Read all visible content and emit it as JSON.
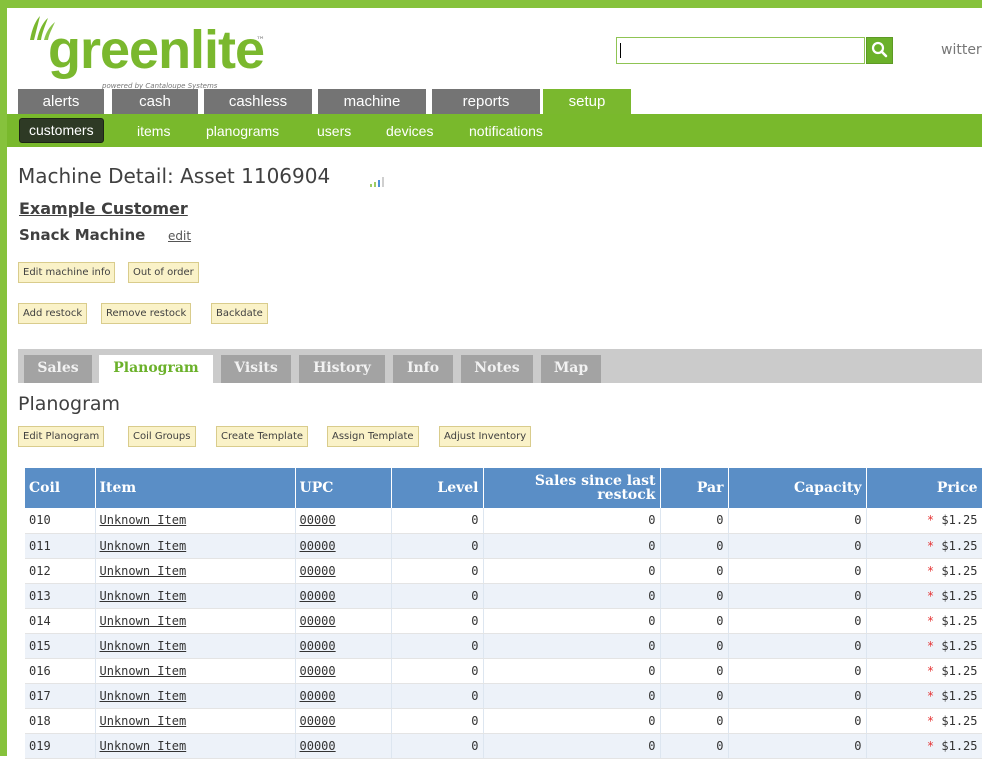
{
  "brand": {
    "logo_name": "greenlite",
    "trademark": "™",
    "powered_by": "powered by Cantaloupe Systems"
  },
  "header": {
    "search_value": "",
    "search_icon": "search-icon",
    "user_name": "witter"
  },
  "main_tabs": [
    {
      "label": "alerts",
      "active": false
    },
    {
      "label": "cash",
      "active": false
    },
    {
      "label": "cashless",
      "active": false
    },
    {
      "label": "machine",
      "active": false
    },
    {
      "label": "reports",
      "active": false
    },
    {
      "label": "setup",
      "active": true
    }
  ],
  "sub_nav": [
    {
      "label": "customers",
      "active": true
    },
    {
      "label": "items",
      "active": false
    },
    {
      "label": "planograms",
      "active": false
    },
    {
      "label": "users",
      "active": false
    },
    {
      "label": "devices",
      "active": false
    },
    {
      "label": "notifications",
      "active": false
    }
  ],
  "page": {
    "title": "Machine Detail: Asset 1106904",
    "signal_icon": "signal-icon",
    "customer": "Example Customer",
    "machine_name": "Snack Machine",
    "edit_label": "edit"
  },
  "machine_buttons": [
    "Edit machine info",
    "Out of order"
  ],
  "restock_buttons": [
    "Add restock",
    "Remove restock",
    "Backdate"
  ],
  "detail_tabs": [
    {
      "label": "Sales",
      "active": false
    },
    {
      "label": "Planogram",
      "active": true
    },
    {
      "label": "Visits",
      "active": false
    },
    {
      "label": "History",
      "active": false
    },
    {
      "label": "Info",
      "active": false
    },
    {
      "label": "Notes",
      "active": false
    },
    {
      "label": "Map",
      "active": false
    }
  ],
  "planogram": {
    "title": "Planogram",
    "buttons": [
      "Edit Planogram",
      "Coil Groups",
      "Create Template",
      "Assign Template",
      "Adjust Inventory"
    ],
    "columns": [
      "Coil",
      "Item",
      "UPC",
      "Level",
      "Sales since last restock",
      "Par",
      "Capacity",
      "Price"
    ],
    "rows": [
      {
        "coil": "010",
        "item": "Unknown Item",
        "upc": "00000",
        "level": "0",
        "sales": "0",
        "par": "0",
        "capacity": "0",
        "star": "*",
        "price": "$1.25"
      },
      {
        "coil": "011",
        "item": "Unknown Item",
        "upc": "00000",
        "level": "0",
        "sales": "0",
        "par": "0",
        "capacity": "0",
        "star": "*",
        "price": "$1.25"
      },
      {
        "coil": "012",
        "item": "Unknown Item",
        "upc": "00000",
        "level": "0",
        "sales": "0",
        "par": "0",
        "capacity": "0",
        "star": "*",
        "price": "$1.25"
      },
      {
        "coil": "013",
        "item": "Unknown Item",
        "upc": "00000",
        "level": "0",
        "sales": "0",
        "par": "0",
        "capacity": "0",
        "star": "*",
        "price": "$1.25"
      },
      {
        "coil": "014",
        "item": "Unknown Item",
        "upc": "00000",
        "level": "0",
        "sales": "0",
        "par": "0",
        "capacity": "0",
        "star": "*",
        "price": "$1.25"
      },
      {
        "coil": "015",
        "item": "Unknown Item",
        "upc": "00000",
        "level": "0",
        "sales": "0",
        "par": "0",
        "capacity": "0",
        "star": "*",
        "price": "$1.25"
      },
      {
        "coil": "016",
        "item": "Unknown Item",
        "upc": "00000",
        "level": "0",
        "sales": "0",
        "par": "0",
        "capacity": "0",
        "star": "*",
        "price": "$1.25"
      },
      {
        "coil": "017",
        "item": "Unknown Item",
        "upc": "00000",
        "level": "0",
        "sales": "0",
        "par": "0",
        "capacity": "0",
        "star": "*",
        "price": "$1.25"
      },
      {
        "coil": "018",
        "item": "Unknown Item",
        "upc": "00000",
        "level": "0",
        "sales": "0",
        "par": "0",
        "capacity": "0",
        "star": "*",
        "price": "$1.25"
      },
      {
        "coil": "019",
        "item": "Unknown Item",
        "upc": "00000",
        "level": "0",
        "sales": "0",
        "par": "0",
        "capacity": "0",
        "star": "*",
        "price": "$1.25"
      }
    ]
  },
  "colors": {
    "brand_green": "#7ab82e",
    "tab_gray": "#747474",
    "table_header": "#5a8ec6",
    "button_bg": "#faf2c8",
    "price_star": "#e53333"
  }
}
